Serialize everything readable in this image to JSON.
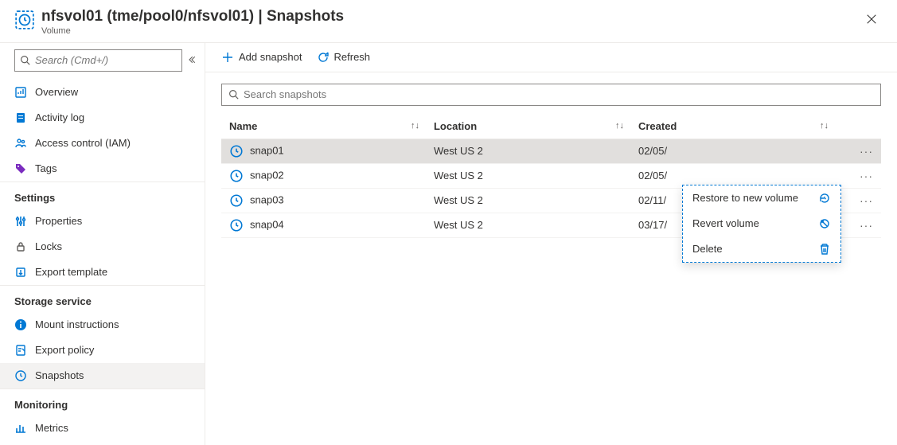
{
  "header": {
    "title": "nfsvol01 (tme/pool0/nfsvol01) | Snapshots",
    "subtitle": "Volume"
  },
  "sidebar": {
    "search_placeholder": "Search (Cmd+/)",
    "groups": [
      {
        "label": "",
        "items": [
          {
            "label": "Overview",
            "icon": "chart-icon",
            "color": "#0078d4"
          },
          {
            "label": "Activity log",
            "icon": "log-icon",
            "color": "#0078d4"
          },
          {
            "label": "Access control (IAM)",
            "icon": "people-icon",
            "color": "#0078d4"
          },
          {
            "label": "Tags",
            "icon": "tag-icon",
            "color": "#7b2cbf"
          }
        ]
      },
      {
        "label": "Settings",
        "items": [
          {
            "label": "Properties",
            "icon": "sliders-icon",
            "color": "#0078d4"
          },
          {
            "label": "Locks",
            "icon": "lock-icon",
            "color": "#605e5c"
          },
          {
            "label": "Export template",
            "icon": "export-icon",
            "color": "#0078d4"
          }
        ]
      },
      {
        "label": "Storage service",
        "items": [
          {
            "label": "Mount instructions",
            "icon": "info-icon",
            "color": "#0078d4"
          },
          {
            "label": "Export policy",
            "icon": "policy-icon",
            "color": "#0078d4"
          },
          {
            "label": "Snapshots",
            "icon": "clock-icon",
            "color": "#0078d4",
            "selected": true
          }
        ]
      },
      {
        "label": "Monitoring",
        "items": [
          {
            "label": "Metrics",
            "icon": "metrics-icon",
            "color": "#0078d4"
          }
        ]
      }
    ]
  },
  "toolbar": {
    "add_label": "Add snapshot",
    "refresh_label": "Refresh"
  },
  "grid": {
    "search_placeholder": "Search snapshots",
    "columns": {
      "name": "Name",
      "location": "Location",
      "created": "Created"
    },
    "rows": [
      {
        "name": "snap01",
        "location": "West US 2",
        "created": "02/05/",
        "selected": true
      },
      {
        "name": "snap02",
        "location": "West US 2",
        "created": "02/05/"
      },
      {
        "name": "snap03",
        "location": "West US 2",
        "created": "02/11/"
      },
      {
        "name": "snap04",
        "location": "West US 2",
        "created": "03/17/"
      }
    ]
  },
  "context_menu": {
    "items": [
      {
        "label": "Restore to new volume",
        "icon": "restore-icon"
      },
      {
        "label": "Revert volume",
        "icon": "revert-icon"
      },
      {
        "label": "Delete",
        "icon": "delete-icon"
      }
    ]
  }
}
